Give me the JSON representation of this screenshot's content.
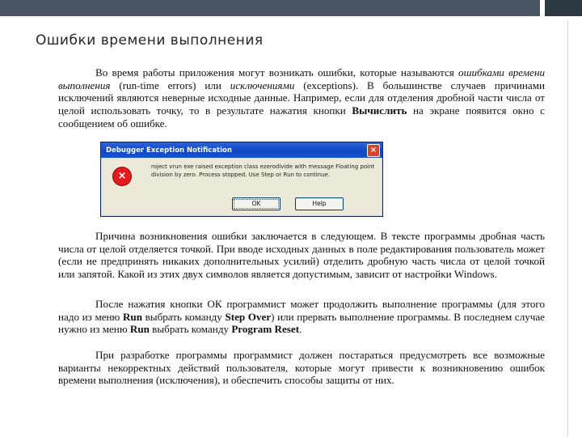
{
  "title": "Ошибки времени выполнения",
  "dialog": {
    "title": "Debugger Exception Notification",
    "close": "×",
    "icon": "×",
    "message": "roject vrun exe raised exception class ezerodivide with message Floating point division by zero. Process stopped. Use Step or Run to continue.",
    "ok_label": "OK",
    "help_label": "Help"
  },
  "p1": {
    "t1": "Во время работы приложения могут возникать ошибки, которые называются ",
    "em1": "ошибками времени выполнения",
    "t2": " (run-time errors) или ",
    "em2": "исключениями",
    "t3": " (exceptions). В большинстве случаев причинами исключений являются неверные исходные данные. Например, если для отделения дробной части числа от целой использовать точку, то в результате нажатия кнопки ",
    "b1": "Вычислить",
    "t4": " на экране появится окно с сообщением об ошибке."
  },
  "p2": "Причина возникновения ошибки заключается в следующем. В тексте программы дробная часть числа от целой отделяется точкой. При вводе исходных данных в поле редактирования пользователь может (если не предпринять никаких дополнительных усилий) отделить дробную часть числа от целой точкой или запятой. Какой из этих двух символов является допустимым, зависит от настройки Windows.",
  "p3": {
    "t1": "После нажатия кнопки ОК программист может продолжить выполнение программы (для этого надо из меню ",
    "b1": "Run",
    "t2": " выбрать команду ",
    "b2": "Step Over",
    "t3": ") или прервать выполнение программы. В последнем случае нужно из меню ",
    "b3": "Run",
    "t4": " выбрать команду ",
    "b4": "Program Reset",
    "t5": "."
  },
  "p4": "При разработке программы программист должен постараться предусмотреть все возможные варианты некорректных действий пользователя, которые могут привести к возникновению ошибок времени выполнения (исключения), и обеспечить способы защиты от них."
}
